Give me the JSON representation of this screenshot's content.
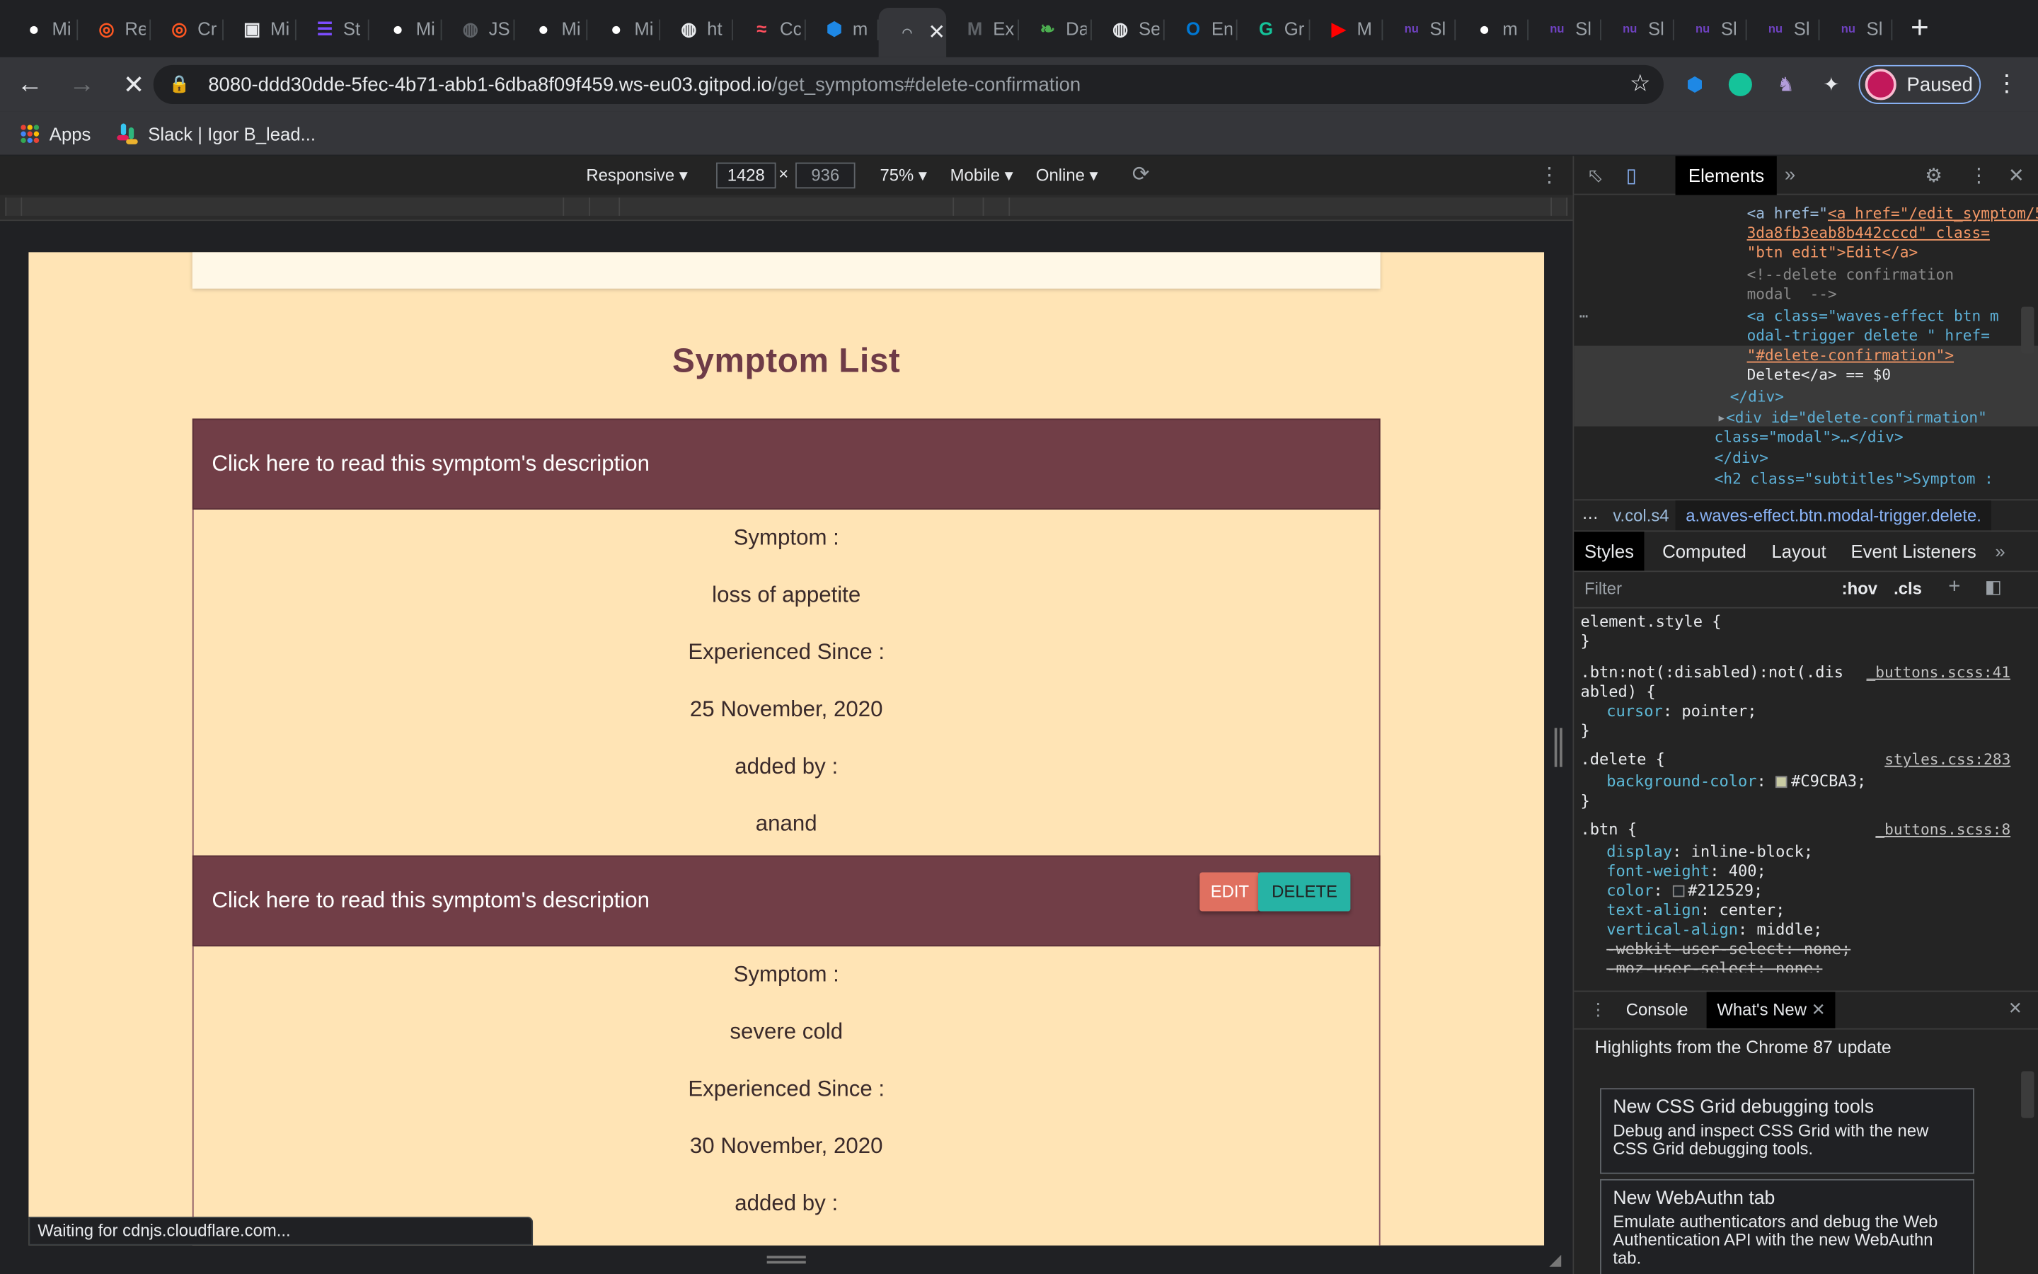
{
  "tabs": [
    {
      "title": "Mi",
      "icon": "github-icon",
      "color": "#ffffff"
    },
    {
      "title": "Re",
      "icon": "record-icon",
      "color": "#ff5722"
    },
    {
      "title": "Cr",
      "icon": "record-icon",
      "color": "#ff5722"
    },
    {
      "title": "Mi",
      "icon": "app-icon",
      "color": "#e8eaed"
    },
    {
      "title": "St",
      "icon": "list-icon",
      "color": "#7c4dff"
    },
    {
      "title": "Mi",
      "icon": "github-icon",
      "color": "#ffffff"
    },
    {
      "title": "JS",
      "icon": "globe-icon",
      "color": "#5f6368"
    },
    {
      "title": "Mi",
      "icon": "github-icon",
      "color": "#ffffff"
    },
    {
      "title": "Mi",
      "icon": "github-icon",
      "color": "#ffffff"
    },
    {
      "title": "ht",
      "icon": "globe-icon",
      "color": "#e8eaed"
    },
    {
      "title": "Cc",
      "icon": "coursera-icon",
      "color": "#ff4f5e"
    },
    {
      "title": "m",
      "icon": "cube-icon",
      "color": "#1e88e5"
    },
    {
      "title": "Ex",
      "icon": "markdown-icon",
      "color": "#5f6368"
    },
    {
      "title": "Da",
      "icon": "leaf-icon",
      "color": "#4caf50"
    },
    {
      "title": "Se",
      "icon": "globe-icon",
      "color": "#e8eaed"
    },
    {
      "title": "En",
      "icon": "outlook-icon",
      "color": "#0078d4"
    },
    {
      "title": "Gr",
      "icon": "grammarly-icon",
      "color": "#15c39a"
    },
    {
      "title": "M",
      "icon": "youtube-icon",
      "color": "#ff0000"
    },
    {
      "title": "Sl",
      "icon": "nu-icon",
      "color": "#6f42c1"
    },
    {
      "title": "m",
      "icon": "github-icon",
      "color": "#ffffff"
    },
    {
      "title": "Sl",
      "icon": "nu-icon",
      "color": "#6f42c1"
    },
    {
      "title": "Sl",
      "icon": "nu-icon",
      "color": "#6f42c1"
    },
    {
      "title": "Sl",
      "icon": "nu-icon",
      "color": "#6f42c1"
    },
    {
      "title": "Sl",
      "icon": "nu-icon",
      "color": "#6f42c1"
    },
    {
      "title": "Sl",
      "icon": "nu-icon",
      "color": "#6f42c1"
    }
  ],
  "active_tab": {
    "icon": "loading-icon"
  },
  "address": {
    "host": "8080-ddd30dde-5fec-4b71-abb1-6dba8f09f459.ws-eu03.gitpod.io",
    "path": "/get_symptoms#delete-confirmation"
  },
  "profile": {
    "label": "Paused"
  },
  "bookmarks": [
    {
      "label": "Apps",
      "icon": "apps-grid-icon"
    },
    {
      "label": "Slack | Igor B_lead...",
      "icon": "slack-icon"
    }
  ],
  "device_toolbar": {
    "mode": "Responsive",
    "width": "1428",
    "height": "936",
    "zoom": "75%",
    "throttle_device": "Mobile",
    "network": "Online"
  },
  "page": {
    "title": "Symptom List",
    "items": [
      {
        "header": "Click here to read this symptom's description",
        "symptom_label": "Symptom :",
        "symptom": "loss of appetite",
        "since_label": "Experienced Since :",
        "since": "25 November, 2020",
        "added_label": "added by :",
        "added_by": "anand"
      },
      {
        "header": "Click here to read this symptom's description",
        "edit_label": "EDIT",
        "delete_label": "DELETE",
        "symptom_label": "Symptom :",
        "symptom": "severe cold",
        "since_label": "Experienced Since :",
        "since": "30 November, 2020",
        "added_label": "added by :"
      }
    ]
  },
  "status_text": "Waiting for cdnjs.cloudflare.com...",
  "devtools": {
    "panel_tab": "Elements",
    "code_lines": [
      "<a href=\"/edit_symptom/5fc7a",
      "3da8fb3eab8b442cccd\" class=",
      "\"btn edit\">Edit</a>",
      "<!--delete confirmation",
      "modal  -->",
      "<a class=\"waves-effect btn m",
      "odal-trigger delete \" href=",
      "\"#delete-confirmation\">",
      "Delete</a> == $0",
      "</div>",
      "<div id=\"delete-confirmation\"",
      "class=\"modal\">…</div>",
      "</div>",
      "<h2 class=\"subtitles\">Symptom :"
    ],
    "breadcrumb_prev": "v.col.s4",
    "breadcrumb_active": "a.waves-effect.btn.modal-trigger.delete.",
    "style_tabs": [
      "Styles",
      "Computed",
      "Layout",
      "Event Listeners"
    ],
    "filter_placeholder": "Filter",
    "filter_hov": ":hov",
    "filter_cls": ".cls",
    "rules": {
      "element_style": "element.style {",
      "btn_not_sel1": ".btn:not(:disabled):not(.dis",
      "btn_not_sel2": "abled) {",
      "btn_not_src": "_buttons.scss:41",
      "cursor_prop": "cursor",
      "cursor_val": "pointer;",
      "delete_sel": ".delete {",
      "delete_src": "styles.css:283",
      "bg_prop": "background-color",
      "bg_val": "#C9CBA3;",
      "btn_sel": ".btn {",
      "btn_src": "_buttons.scss:8",
      "display_prop": "display",
      "display_val": "inline-block;",
      "fw_prop": "font-weight",
      "fw_val": "400;",
      "color_prop": "color",
      "color_val": "#212529;",
      "ta_prop": "text-align",
      "ta_val": "center;",
      "va_prop": "vertical-align",
      "va_val": "middle;",
      "wus_text": "-webkit-user-select: none;",
      "mus_text": "-moz-user-select: none;"
    },
    "drawer_tabs": [
      "Console",
      "What's New"
    ],
    "whats_new_title": "Highlights from the Chrome 87 update",
    "cards": [
      {
        "title": "New CSS Grid debugging tools",
        "body": "Debug and inspect CSS Grid with the new CSS Grid debugging tools."
      },
      {
        "title": "New WebAuthn tab",
        "body": "Emulate authenticators and debug the Web Authentication API with the new WebAuthn tab."
      }
    ]
  },
  "colors": {
    "page_bg": "#ffe4b5",
    "header_bg": "#713e47",
    "title_color": "#6e3b47",
    "edit_btn": "#e07060",
    "delete_btn": "#26b3a5"
  }
}
